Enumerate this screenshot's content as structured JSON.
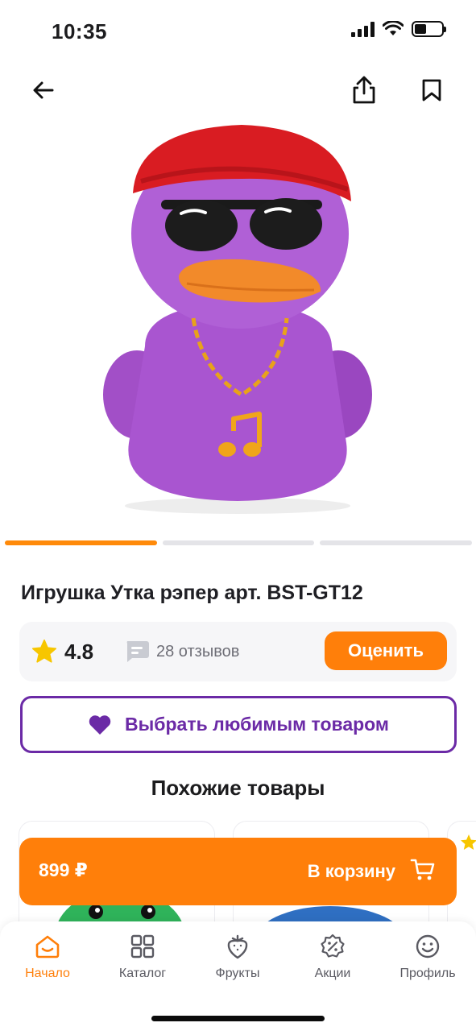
{
  "status_bar": {
    "time": "10:35"
  },
  "product": {
    "title": "Игрушка Утка рэпер арт. BST-GT12",
    "image_alt": "Purple plush duck with red cap, sunglasses and gold chain",
    "gallery": {
      "count": 3,
      "active_index": 0
    },
    "rating": "4.8",
    "reviews": "28 отзывов",
    "rate_button": "Оценить",
    "favorite_button": "Выбрать любимым товаром"
  },
  "similar": {
    "title": "Похожие товары"
  },
  "cart_bar": {
    "price": "899 ₽",
    "label": "В корзину"
  },
  "tabbar": {
    "items": [
      {
        "label": "Начало",
        "icon": "home-icon",
        "active": true
      },
      {
        "label": "Каталог",
        "icon": "grid-icon",
        "active": false
      },
      {
        "label": "Фрукты",
        "icon": "strawberry-icon",
        "active": false
      },
      {
        "label": "Акции",
        "icon": "discount-icon",
        "active": false
      },
      {
        "label": "Профиль",
        "icon": "smile-icon",
        "active": false
      }
    ]
  },
  "colors": {
    "accent": "#ff7f0a",
    "purple": "#6b2aa6",
    "star": "#f7c600"
  }
}
